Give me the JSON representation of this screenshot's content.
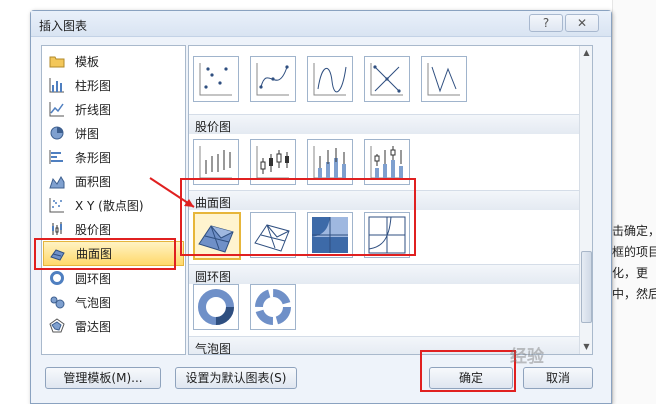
{
  "dialog": {
    "title": "插入图表",
    "help_label": "?",
    "close_label": "✕"
  },
  "categories": [
    {
      "label": "模板",
      "icon": "folder-icon"
    },
    {
      "label": "柱形图",
      "icon": "column-chart-icon"
    },
    {
      "label": "折线图",
      "icon": "line-chart-icon"
    },
    {
      "label": "饼图",
      "icon": "pie-chart-icon"
    },
    {
      "label": "条形图",
      "icon": "bar-chart-icon"
    },
    {
      "label": "面积图",
      "icon": "area-chart-icon"
    },
    {
      "label": "X Y (散点图)",
      "icon": "scatter-chart-icon"
    },
    {
      "label": "股价图",
      "icon": "stock-chart-icon"
    },
    {
      "label": "曲面图",
      "icon": "surface-chart-icon",
      "selected": true
    },
    {
      "label": "圆环图",
      "icon": "doughnut-chart-icon"
    },
    {
      "label": "气泡图",
      "icon": "bubble-chart-icon"
    },
    {
      "label": "雷达图",
      "icon": "radar-chart-icon"
    }
  ],
  "groups": {
    "stock": "股价图",
    "surface": "曲面图",
    "doughnut": "圆环图",
    "bubble": "气泡图"
  },
  "buttons": {
    "manage_templates": "管理模板(M)...",
    "set_default": "设置为默认图表(S)",
    "ok": "确定",
    "cancel": "取消"
  },
  "background_doc": {
    "lines": [
      "击确定，",
      "框的项目",
      "化，更",
      "中，然后"
    ]
  },
  "colors": {
    "selection_fill": "#ffd86a",
    "annotation_red": "#e02020",
    "chart_blue": "#4f7fc0"
  },
  "watermark": "经验"
}
